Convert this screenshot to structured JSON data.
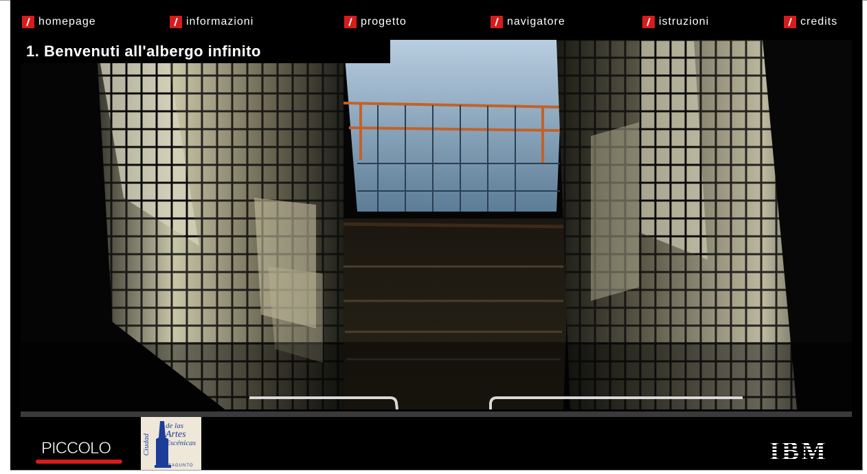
{
  "nav": {
    "items": [
      {
        "label": "homepage"
      },
      {
        "label": "informazioni"
      },
      {
        "label": "progetto"
      },
      {
        "label": "navigatore"
      },
      {
        "label": "istruzioni"
      },
      {
        "label": "credits"
      }
    ]
  },
  "page": {
    "title": "1. Benvenuti all'albergo infinito"
  },
  "footer": {
    "logo_piccolo": "PICCOLO",
    "logo_artes_top": "de las",
    "logo_artes_main": "Artes",
    "logo_artes_sub": "Escénicas",
    "logo_artes_side": "Ciudad",
    "logo_artes_bottom": "SAGUNTO",
    "logo_ibm": "IBM"
  },
  "colors": {
    "accent": "#d81b1b",
    "background": "#000000",
    "text": "#ffffff"
  }
}
